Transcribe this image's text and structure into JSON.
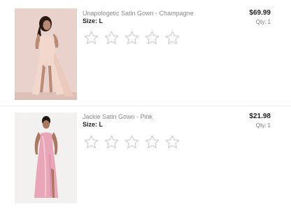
{
  "items": [
    {
      "name": "Unapologetic Satin Gown - Champagne",
      "size_label": "Size:",
      "size_value": "L",
      "price": "$69.99",
      "qty_label": "Qty:",
      "qty_value": "1",
      "rating": 0,
      "image_icon": "model-photo-champagne-gown"
    },
    {
      "name": "Jackie Satin Gown - Pink",
      "size_label": "Size:",
      "size_value": "L",
      "price": "$21.98",
      "qty_label": "Qty:",
      "qty_value": "1",
      "rating": 0,
      "image_icon": "model-photo-pink-gown"
    }
  ],
  "colors": {
    "star_outline": "#d3d3d3",
    "text_primary": "#222222",
    "text_secondary": "#8a8a8a"
  }
}
